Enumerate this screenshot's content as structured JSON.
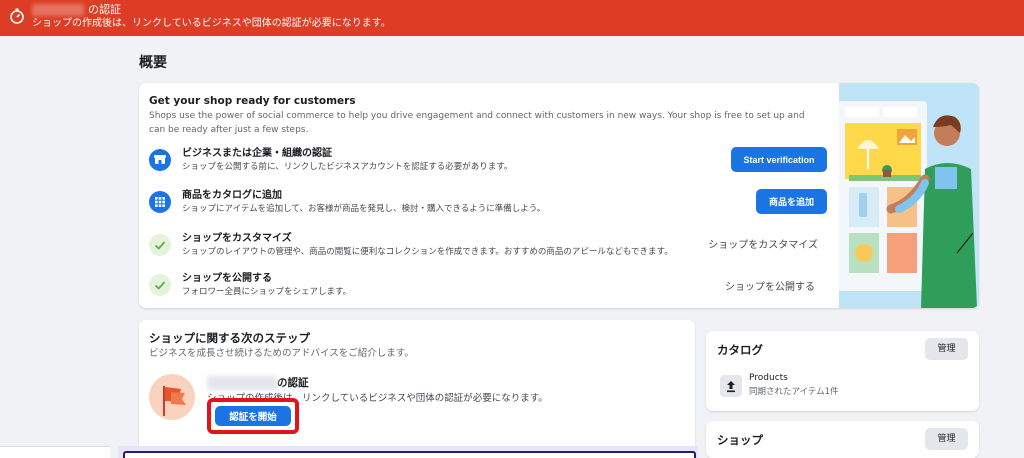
{
  "banner": {
    "title_suffix": "の認証",
    "message": "ショップの作成後は、リンクしているビジネスや団体の認証が必要になります。",
    "icon": "stopwatch-icon"
  },
  "page": {
    "title": "概要"
  },
  "setup": {
    "title": "Get your shop ready for customers",
    "description": "Shops use the power of social commerce to help you drive engagement and connect with customers in new ways. Your shop is free to set up and can be ready after just a few steps.",
    "steps": [
      {
        "title": "ビジネスまたは企業・組織の認証",
        "desc": "ショップを公開する前に、リンクしたビジネスアカウントを認証する必要があります。",
        "action": "Start verification",
        "icon": "store-icon",
        "done": false
      },
      {
        "title": "商品をカタログに追加",
        "desc": "ショップにアイテムを追加して、お客様が商品を発見し、検討・購入できるように準備しよう。",
        "action": "商品を追加",
        "icon": "grid-icon",
        "done": false
      },
      {
        "title": "ショップをカスタマイズ",
        "desc": "ショップのレイアウトの管理や、商品の閲覧に便利なコレクションを作成できます。おすすめの商品のアピールなどもできます。",
        "action": "ショップをカスタマイズ",
        "icon": "check-icon",
        "done": true
      },
      {
        "title": "ショップを公開する",
        "desc": "フォロワー全員にショップをシェアします。",
        "action": "ショップを公開する",
        "icon": "check-icon",
        "done": true
      }
    ]
  },
  "next_steps": {
    "title": "ショップに関する次のステップ",
    "subtitle": "ビジネスを成長させ続けるためのアドバイスをご紹介します。",
    "verify_title_suffix": "の認証",
    "verify_desc": "ショップの作成後は、リンクしているビジネスや団体の認証が必要になります。",
    "verify_button": "認証を開始"
  },
  "catalog": {
    "title": "カタログ",
    "manage": "管理",
    "product_title": "Products",
    "product_sub": "同期されたアイテム1件"
  },
  "shop": {
    "title": "ショップ",
    "manage": "管理"
  },
  "colors": {
    "banner": "#dc3d24",
    "primary": "#1b74e4",
    "highlight": "#e3131a",
    "done_bg": "#e4f3dc"
  }
}
